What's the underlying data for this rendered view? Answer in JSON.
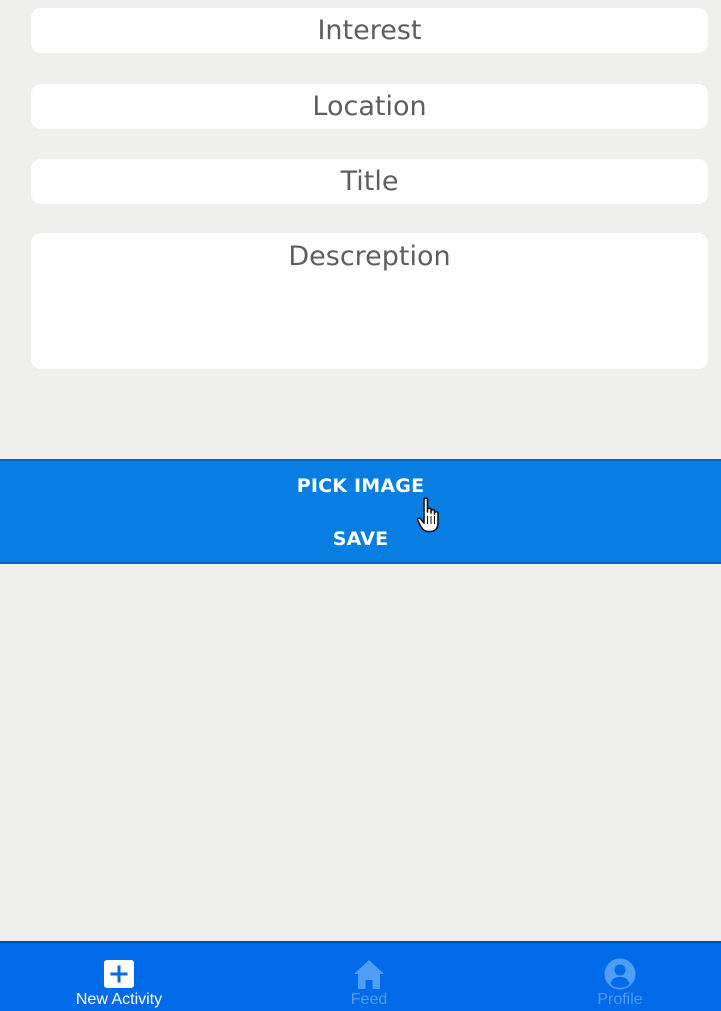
{
  "form": {
    "interest_placeholder": "Interest",
    "location_placeholder": "Location",
    "title_placeholder": "Title",
    "description_placeholder": "Descreption"
  },
  "actions": {
    "pick_image_label": "PICK IMAGE",
    "save_label": "SAVE"
  },
  "bottom_nav": {
    "items": [
      {
        "label": "New Activity",
        "icon": "plus-square-icon",
        "active": true
      },
      {
        "label": "Feed",
        "icon": "home-icon",
        "active": false
      },
      {
        "label": "Profile",
        "icon": "user-circle-icon",
        "active": false
      }
    ]
  },
  "colors": {
    "background": "#efefed",
    "field_background": "#fefefe",
    "placeholder_text": "#5e5e5e",
    "action_panel": "#087ee3",
    "nav_bar": "#006ae8",
    "nav_active": "#ffffff",
    "nav_inactive": "#4f9df5"
  }
}
